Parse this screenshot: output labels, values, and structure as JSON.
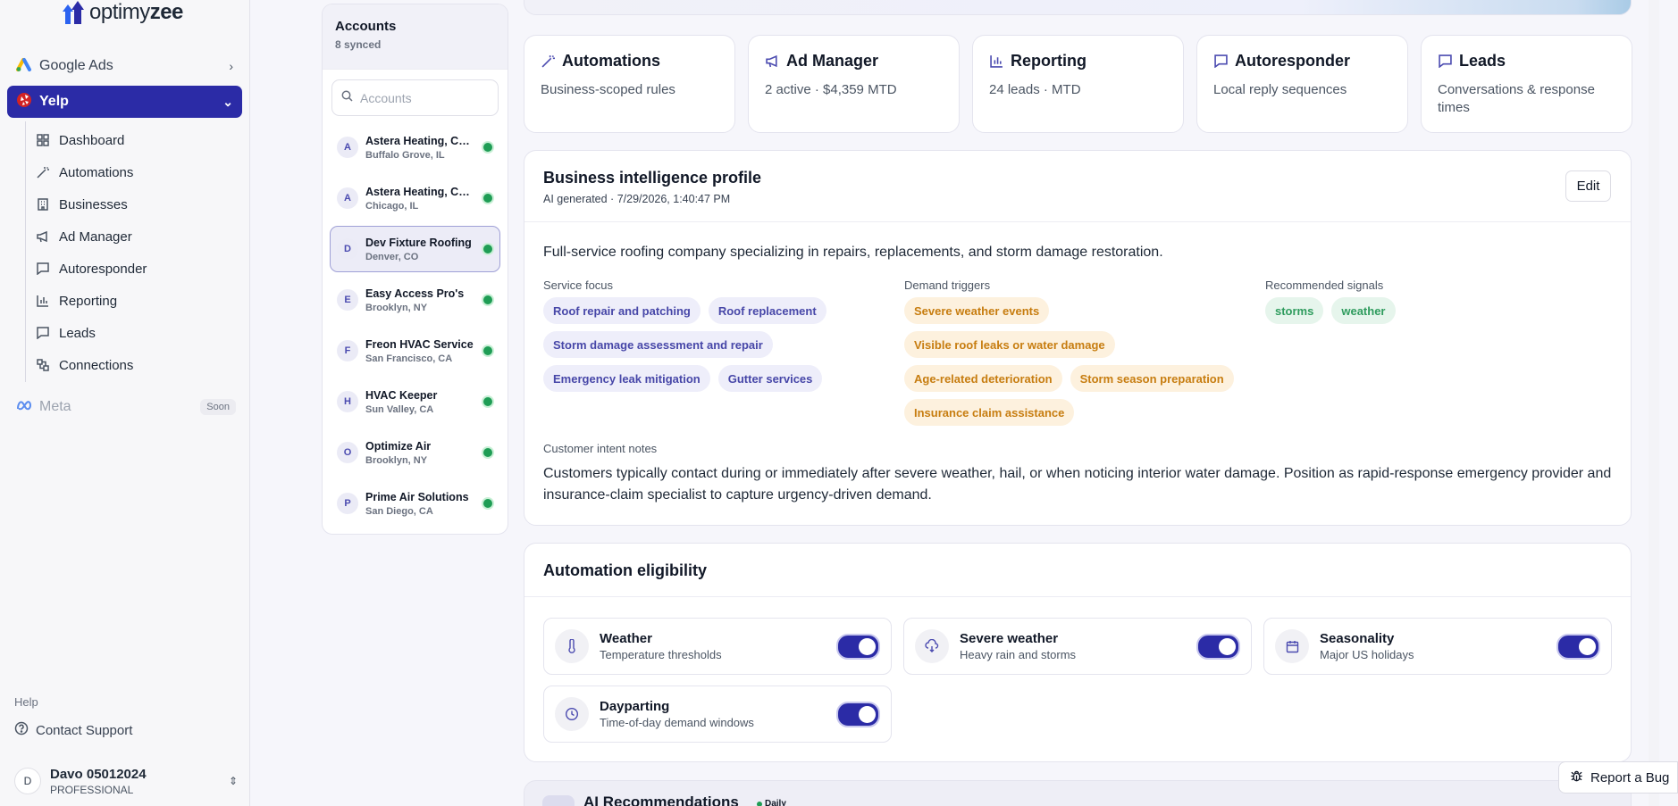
{
  "brand": {
    "name_light": "optimy",
    "name_bold": "zee"
  },
  "nav": {
    "google_ads": "Google Ads",
    "yelp": "Yelp",
    "sub_items": [
      {
        "label": "Dashboard",
        "icon": "grid-icon"
      },
      {
        "label": "Automations",
        "icon": "wand-icon"
      },
      {
        "label": "Businesses",
        "icon": "building-icon"
      },
      {
        "label": "Ad Manager",
        "icon": "megaphone-icon"
      },
      {
        "label": "Autoresponder",
        "icon": "chat-icon"
      },
      {
        "label": "Reporting",
        "icon": "bar-chart-icon"
      },
      {
        "label": "Leads",
        "icon": "chat-icon"
      },
      {
        "label": "Connections",
        "icon": "connection-icon"
      }
    ],
    "meta": "Meta",
    "meta_badge": "Soon",
    "help_label": "Help",
    "contact_support": "Contact Support"
  },
  "user": {
    "initial": "D",
    "name": "Davo 05012024",
    "plan": "PROFESSIONAL"
  },
  "accounts": {
    "title": "Accounts",
    "subtitle": "8 synced",
    "search_placeholder": "Accounts",
    "items": [
      {
        "initial": "A",
        "name": "Astera Heating, Cooling",
        "location": "Buffalo Grove, IL",
        "selected": false
      },
      {
        "initial": "A",
        "name": "Astera Heating, Cooling",
        "location": "Chicago, IL",
        "selected": false
      },
      {
        "initial": "D",
        "name": "Dev Fixture Roofing",
        "location": "Denver, CO",
        "selected": true
      },
      {
        "initial": "E",
        "name": "Easy Access Pro's",
        "location": "Brooklyn, NY",
        "selected": false
      },
      {
        "initial": "F",
        "name": "Freon HVAC Service",
        "location": "San Francisco, CA",
        "selected": false
      },
      {
        "initial": "H",
        "name": "HVAC Keeper",
        "location": "Sun Valley, CA",
        "selected": false
      },
      {
        "initial": "O",
        "name": "Optimize Air",
        "location": "Brooklyn, NY",
        "selected": false
      },
      {
        "initial": "P",
        "name": "Prime Air Solutions",
        "location": "San Diego, CA",
        "selected": false
      }
    ]
  },
  "cards": [
    {
      "title": "Automations",
      "subtitle": "Business-scoped rules",
      "icon": "wand-icon"
    },
    {
      "title": "Ad Manager",
      "subtitle": "2 active · $4,359 MTD",
      "icon": "megaphone-icon"
    },
    {
      "title": "Reporting",
      "subtitle": "24 leads · MTD",
      "icon": "bar-chart-icon"
    },
    {
      "title": "Autoresponder",
      "subtitle": "Local reply sequences",
      "icon": "chat-icon"
    },
    {
      "title": "Leads",
      "subtitle": "Conversations & response times",
      "icon": "chat-icon"
    }
  ],
  "bip": {
    "title": "Business intelligence profile",
    "meta": "AI generated · 7/29/2026, 1:40:47 PM",
    "edit_label": "Edit",
    "summary": "Full-service roofing company specializing in repairs, replacements, and storm damage restoration.",
    "service_focus_label": "Service focus",
    "service_focus": [
      "Roof repair and patching",
      "Roof replacement",
      "Storm damage assessment and repair",
      "Emergency leak mitigation",
      "Gutter services"
    ],
    "demand_triggers_label": "Demand triggers",
    "demand_triggers": [
      "Severe weather events",
      "Visible roof leaks or water damage",
      "Age-related deterioration",
      "Storm season preparation",
      "Insurance claim assistance"
    ],
    "signals_label": "Recommended signals",
    "signals": [
      "storms",
      "weather"
    ],
    "notes_label": "Customer intent notes",
    "notes": "Customers typically contact during or immediately after severe weather, hail, or when noticing interior water damage. Position as rapid-response emergency provider and insurance-claim specialist to capture urgency-driven demand."
  },
  "eligibility": {
    "title": "Automation eligibility",
    "items": [
      {
        "title": "Weather",
        "subtitle": "Temperature thresholds",
        "icon": "thermometer-icon",
        "enabled": true
      },
      {
        "title": "Severe weather",
        "subtitle": "Heavy rain and storms",
        "icon": "cloud-rain-icon",
        "enabled": true
      },
      {
        "title": "Seasonality",
        "subtitle": "Major US holidays",
        "icon": "calendar-icon",
        "enabled": true
      },
      {
        "title": "Dayparting",
        "subtitle": "Time-of-day demand windows",
        "icon": "clock-icon",
        "enabled": true
      }
    ]
  },
  "ai": {
    "title": "AI Recommendations",
    "badge": "Daily"
  },
  "bug_button": "Report a Bug",
  "colors": {
    "accent": "#2b2ba6",
    "purple_chip": "#4747a8",
    "orange_chip": "#c77d10",
    "green_chip": "#2f9c5e",
    "status_green": "#1f9d55"
  }
}
